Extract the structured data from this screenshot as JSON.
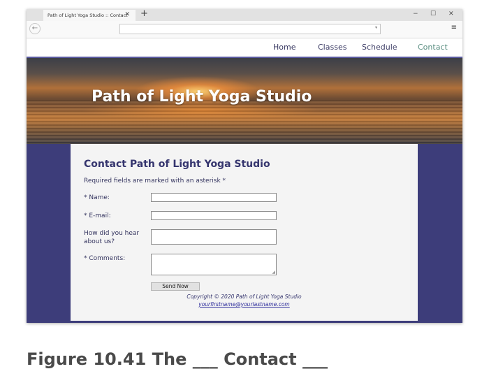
{
  "browser": {
    "tab_title": "Path of Light Yoga Studio :: Contact",
    "tab_close": "✕",
    "new_tab": "+",
    "minimize": "−",
    "maximize": "☐",
    "close": "✕",
    "back": "←",
    "url_value": "",
    "url_dropdown": "▾",
    "menu": "≡"
  },
  "nav": {
    "items": [
      "Home",
      "Classes",
      "Schedule",
      "Contact"
    ],
    "active": "Contact"
  },
  "hero": {
    "title": "Path of Light Yoga Studio"
  },
  "form": {
    "title": "Contact Path of Light Yoga Studio",
    "required_note": "Required fields are marked with an asterisk *",
    "name_label": "* Name:",
    "email_label": "* E-mail:",
    "hear_label": "How did you hear about us?",
    "comments_label": "* Comments:",
    "name_value": "",
    "email_value": "",
    "hear_value": "",
    "comments_value": "",
    "send_label": "Send Now"
  },
  "footer": {
    "copyright": "Copyright © 2020 Path of Light Yoga Studio",
    "email": "yourfirstname@yourlastname.com"
  },
  "caption": "Figure 10.41 The ___ Contact ___",
  "colors": {
    "nav_text": "#3a3a63",
    "nav_active": "#5b8f82",
    "purple_bg": "#3d3d7a",
    "content_bg": "#f4f4f4",
    "heading": "#35356e"
  }
}
